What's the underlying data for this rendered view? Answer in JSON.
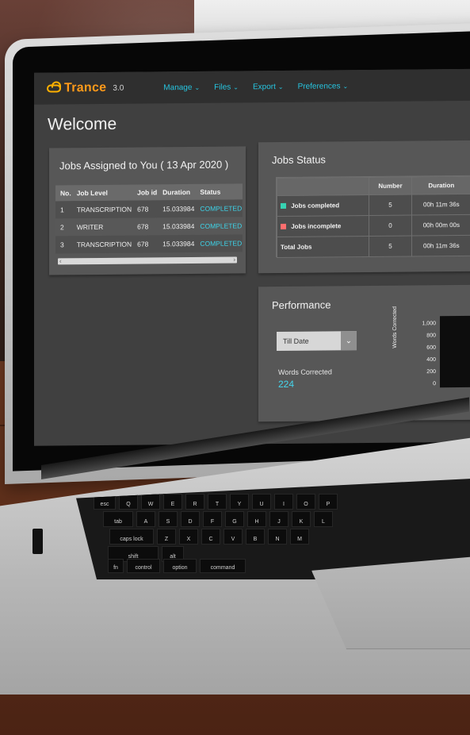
{
  "app": {
    "name": "Trance",
    "version": "3.0"
  },
  "nav": {
    "items": [
      {
        "label": "Manage"
      },
      {
        "label": "Files"
      },
      {
        "label": "Export"
      },
      {
        "label": "Preferences"
      }
    ]
  },
  "page": {
    "title": "Welcome"
  },
  "jobs_assigned": {
    "title": "Jobs Assigned to You ( 13 Apr 2020 )",
    "headers": [
      "No.",
      "Job Level",
      "Job id",
      "Duration",
      "Status"
    ],
    "rows": [
      [
        "1",
        "TRANSCRIPTION",
        "678",
        "15.033984",
        "COMPLETED"
      ],
      [
        "2",
        "WRITER",
        "678",
        "15.033984",
        "COMPLETED"
      ],
      [
        "3",
        "TRANSCRIPTION",
        "678",
        "15.033984",
        "COMPLETED"
      ]
    ]
  },
  "jobs_status": {
    "title": "Jobs Status",
    "headers": [
      "",
      "Number",
      "Duration"
    ],
    "rows": [
      {
        "label": "Jobs completed",
        "number": "5",
        "duration": "00h 11m 36s"
      },
      {
        "label": "Jobs incomplete",
        "number": "0",
        "duration": "00h 00m 00s"
      },
      {
        "label": "Total Jobs",
        "number": "5",
        "duration": "00h 11m 36s"
      }
    ],
    "colors": {
      "completed": "#37d3b3",
      "incomplete": "#ff6e6e"
    }
  },
  "performance": {
    "title": "Performance",
    "select_value": "Till Date",
    "words_label": "Words Corrected",
    "words_value": "224"
  },
  "chart_data": {
    "type": "bar",
    "ylabel": "Words Corrected",
    "ytick_labels": [
      "0",
      "200",
      "400",
      "600",
      "800",
      "1,000"
    ],
    "ylim": [
      0,
      1000
    ]
  },
  "keyboard": {
    "labels": [
      "esc",
      "tab",
      "caps lock",
      "shift",
      "fn",
      "control",
      "option",
      "command",
      "alt",
      "Q",
      "W",
      "E",
      "R",
      "T",
      "Y",
      "U",
      "I",
      "O",
      "P",
      "A",
      "S",
      "D",
      "F",
      "G",
      "H",
      "J",
      "K",
      "L",
      "Z",
      "X",
      "C",
      "V",
      "B",
      "N",
      "M"
    ]
  }
}
